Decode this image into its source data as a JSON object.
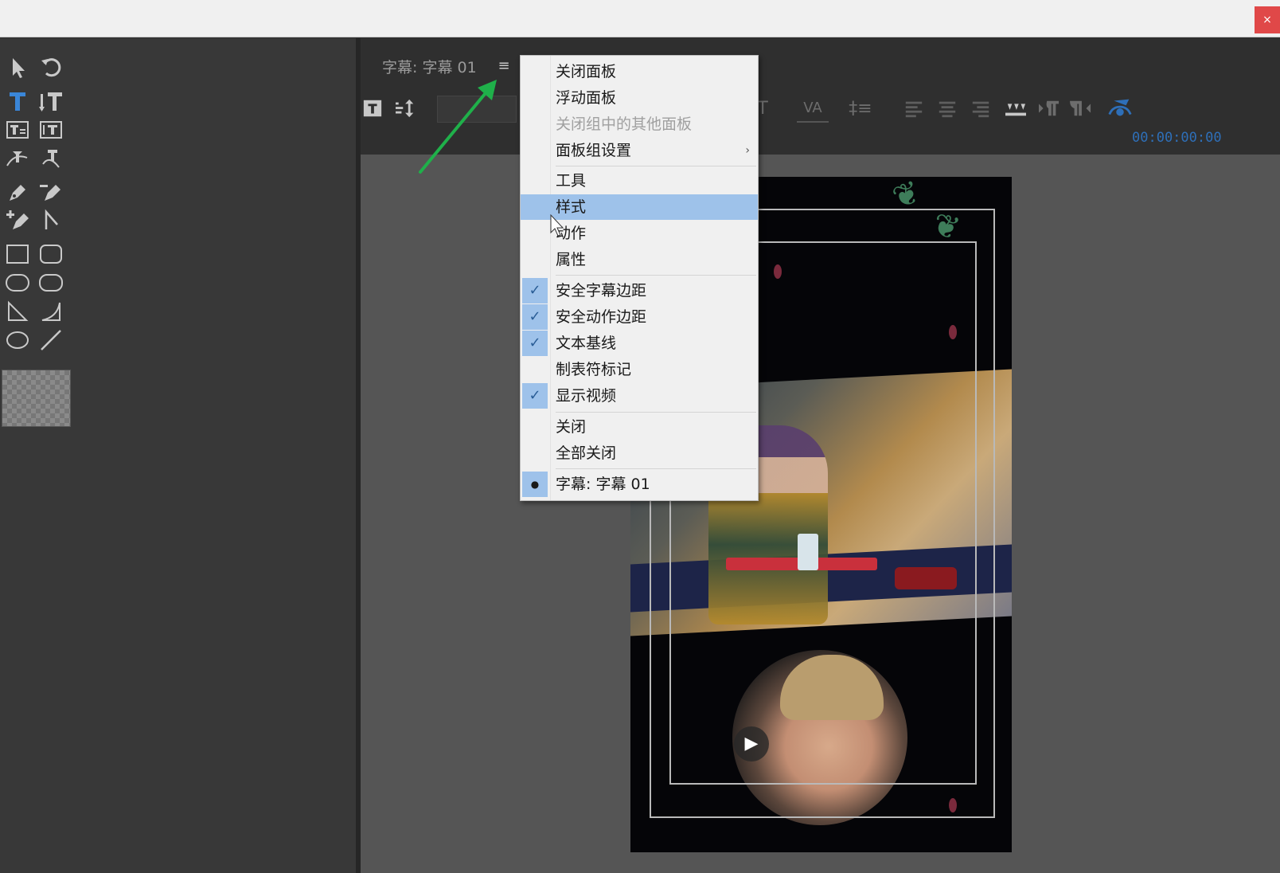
{
  "window": {
    "close_glyph": "×"
  },
  "panel": {
    "title": "字幕: 字幕 01",
    "menu_icon": "≡",
    "timecode": "00:00:00:00"
  },
  "tools": {
    "icons": [
      "selection-icon",
      "rotate-icon",
      "type-tool-icon",
      "vertical-type-tool-icon",
      "area-type-icon",
      "vertical-area-type-icon",
      "path-type-icon",
      "vertical-path-type-icon",
      "pen-icon",
      "delete-anchor-icon",
      "add-anchor-icon",
      "convert-anchor-icon",
      "rectangle-icon",
      "rounded-rectangle-icon",
      "clipped-rectangle-icon",
      "rounded-corner-rectangle-icon",
      "wedge-icon",
      "arc-icon",
      "ellipse-icon",
      "line-icon"
    ]
  },
  "toolbar": {
    "icons": [
      "new-title-icon",
      "roll-crawl-icon",
      "font-size-icon",
      "kerning-icon",
      "leading-icon",
      "align-left-icon",
      "align-center-icon",
      "align-right-icon",
      "tab-stops-icon",
      "tab-left-icon",
      "tab-right-icon",
      "show-background-video-icon"
    ],
    "glyphs": {
      "font_size": "ıT",
      "kerning": "VA",
      "leading": "‡≡"
    }
  },
  "menu": {
    "items": [
      {
        "label": "关闭面板",
        "state": "normal"
      },
      {
        "label": "浮动面板",
        "state": "normal"
      },
      {
        "label": "关闭组中的其他面板",
        "state": "disabled"
      },
      {
        "label": "面板组设置",
        "state": "submenu"
      },
      {
        "label": "工具",
        "state": "normal"
      },
      {
        "label": "样式",
        "state": "highlighted"
      },
      {
        "label": "动作",
        "state": "normal"
      },
      {
        "label": "属性",
        "state": "normal"
      },
      {
        "label": "安全字幕边距",
        "state": "checked"
      },
      {
        "label": "安全动作边距",
        "state": "checked"
      },
      {
        "label": "文本基线",
        "state": "checked"
      },
      {
        "label": "制表符标记",
        "state": "normal"
      },
      {
        "label": "显示视频",
        "state": "checked"
      },
      {
        "label": "关闭",
        "state": "normal"
      },
      {
        "label": "全部关闭",
        "state": "normal"
      },
      {
        "label": "字幕: 字幕 01",
        "state": "current"
      }
    ],
    "check_glyph": "✓",
    "bullet_glyph": "●",
    "submenu_glyph": "›"
  },
  "video": {
    "play_glyph": "▶"
  },
  "colors": {
    "annotation_arrow": "#1fb04a",
    "highlight": "#9ec2ea",
    "timecode": "#2e6fb8"
  }
}
